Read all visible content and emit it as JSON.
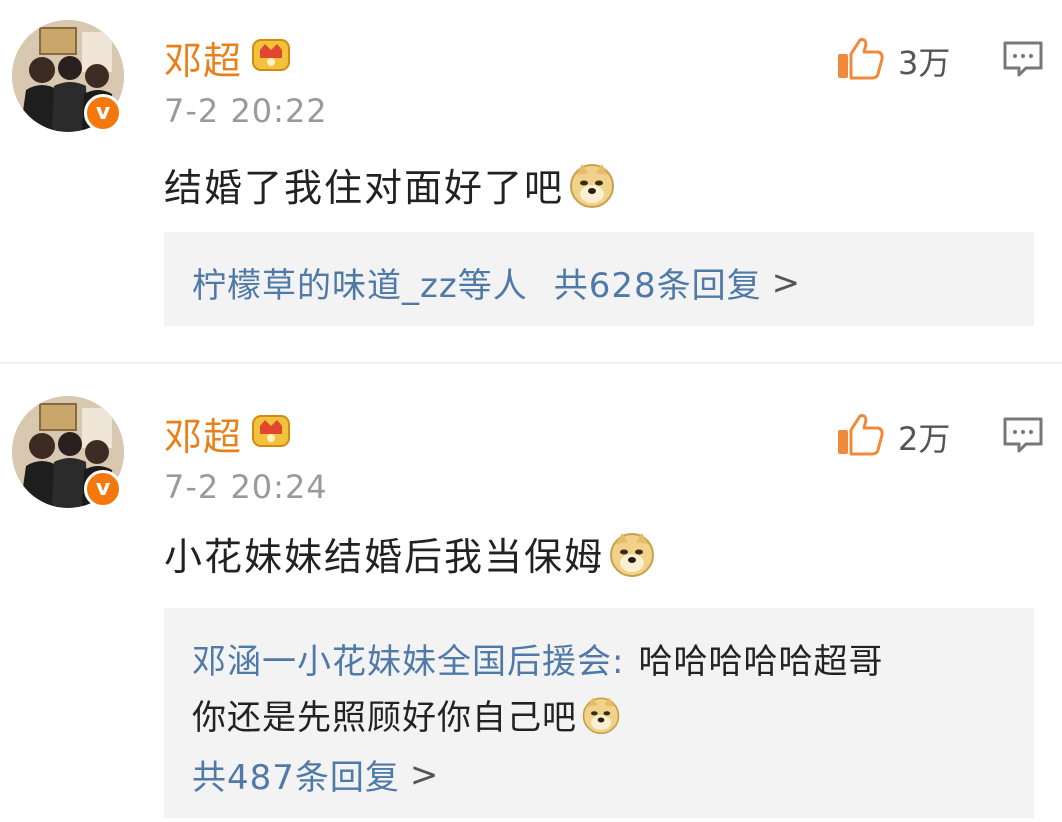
{
  "comments": [
    {
      "user": "邓超",
      "time": "7-2 20:22",
      "text": "结婚了我住对面好了吧",
      "likes": "3万",
      "replies": {
        "users_text": "柠檬草的味道_zz等人",
        "count_text": "共628条回复",
        "chevron": ">"
      }
    },
    {
      "user": "邓超",
      "time": "7-2 20:24",
      "text": "小花妹妹结婚后我当保姆",
      "likes": "2万",
      "replies": {
        "top_reply_user": "邓涵一小花妹妹全国后援会:",
        "top_reply_text_1": "哈哈哈哈哈超哥",
        "top_reply_text_2": "你还是先照顾好你自己吧",
        "count_text": "共487条回复",
        "chevron": ">"
      }
    }
  ],
  "icons": {
    "avatar": "avatar-photo",
    "verified": "verified-v-badge",
    "crown": "crown-icon",
    "doge": "doge-emoji",
    "like": "thumbs-up-icon",
    "reply": "comment-icon"
  },
  "colors": {
    "username": "#e8811a",
    "link": "#4f7aa8",
    "badge": "#f5780d",
    "reply_bg": "#f3f3f3"
  }
}
